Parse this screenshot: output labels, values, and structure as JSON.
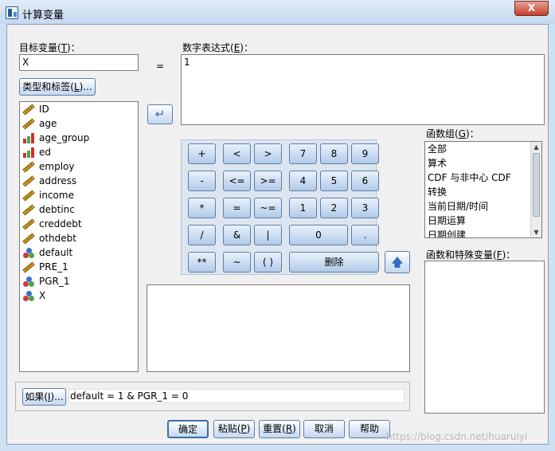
{
  "window": {
    "title": "计算变量",
    "close_symbol": "X"
  },
  "target": {
    "label": "目标变量(",
    "label_key": "T",
    "label_end": ")：",
    "value": "X",
    "type_button": {
      "label": "类型和标签(",
      "key": "L",
      "end": ")..."
    }
  },
  "equals": "=",
  "expression": {
    "label": "数字表达式(",
    "label_key": "E",
    "label_end": ")：",
    "value": "1"
  },
  "variables": [
    {
      "name": "ID",
      "icon": "scale-ruler-icon"
    },
    {
      "name": "age",
      "icon": "scale-ruler-icon"
    },
    {
      "name": "age_group",
      "icon": "ordinal-bars-icon"
    },
    {
      "name": "ed",
      "icon": "ordinal-bars-icon"
    },
    {
      "name": "employ",
      "icon": "scale-ruler-icon"
    },
    {
      "name": "address",
      "icon": "scale-ruler-icon"
    },
    {
      "name": "income",
      "icon": "scale-ruler-icon"
    },
    {
      "name": "debtinc",
      "icon": "scale-ruler-icon"
    },
    {
      "name": "creddebt",
      "icon": "scale-ruler-icon"
    },
    {
      "name": "othdebt",
      "icon": "scale-ruler-icon"
    },
    {
      "name": "default",
      "icon": "nominal-balls-icon"
    },
    {
      "name": "PRE_1",
      "icon": "scale-ruler-icon"
    },
    {
      "name": "PGR_1",
      "icon": "nominal-balls-icon"
    },
    {
      "name": "X",
      "icon": "nominal-balls-icon"
    }
  ],
  "keypad": {
    "plus": "+",
    "less": "<",
    "greater": ">",
    "seven": "7",
    "eight": "8",
    "nine": "9",
    "minus": "-",
    "less_equal": "<=",
    "greater_equal": ">=",
    "four": "4",
    "five": "5",
    "six": "6",
    "multiply": "*",
    "equal": "=",
    "not_equal": "~=",
    "one": "1",
    "two": "2",
    "three": "3",
    "divide": "/",
    "and": "&",
    "or": "|",
    "zero": "0",
    "dot": ".",
    "power": "**",
    "not": "~",
    "parens": "( )",
    "delete": "删除"
  },
  "function_group": {
    "label": "函数组(",
    "label_key": "G",
    "label_end": ")：",
    "items": [
      "全部",
      "算术",
      "CDF 与非中心 CDF",
      "转换",
      "当前日期/时间",
      "日期运算",
      "日期创建"
    ]
  },
  "functions_label": {
    "label": "函数和特殊变量(",
    "key": "F",
    "end": ")："
  },
  "if_condition": {
    "button": {
      "label": "如果(",
      "key": "I",
      "end": ")..."
    },
    "text": "default = 1 & PGR_1 = 0"
  },
  "buttons": {
    "ok": "确定",
    "paste": {
      "label": "粘贴(",
      "key": "P",
      "end": ")"
    },
    "reset": {
      "label": "重置(",
      "key": "R",
      "end": ")"
    },
    "cancel": "取消",
    "help": "帮助"
  },
  "watermark": "https://blog.csdn.net/huaruiyi",
  "colors": {
    "titlebar": "#cfe0f3",
    "close_red": "#c2402c",
    "ruler_yellow": "#e0a91e",
    "bar_red": "#d22f2f",
    "bar_green": "#45a845",
    "ball_blue": "#3f6fcf",
    "ball_red": "#d23a3a",
    "ball_green": "#45a845"
  }
}
